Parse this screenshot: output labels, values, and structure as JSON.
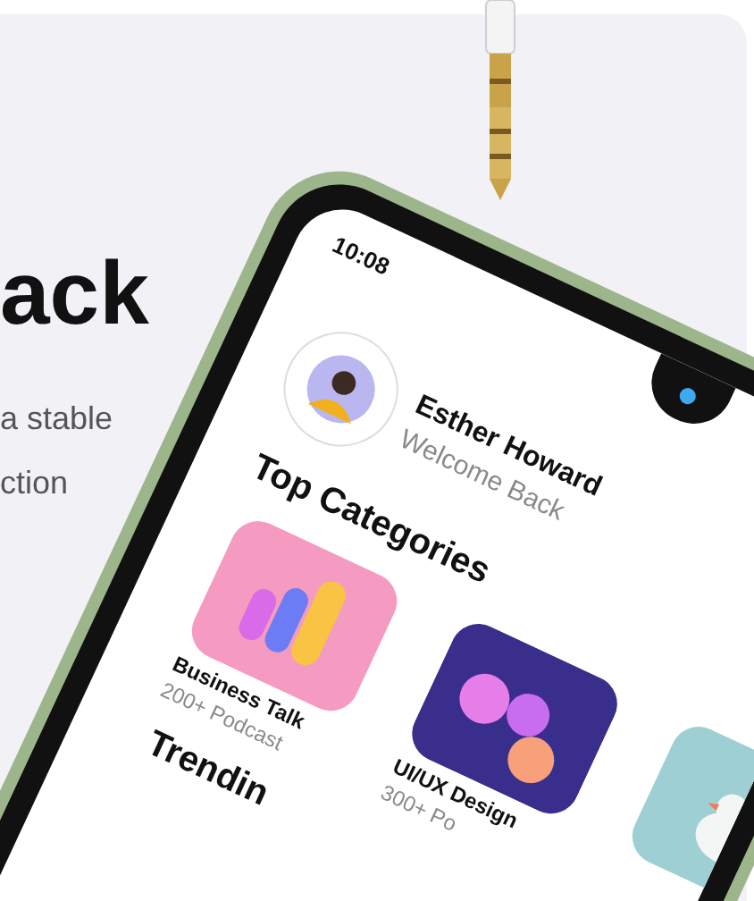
{
  "hero": {
    "title": "ack",
    "lines": [
      "a stable",
      "ction"
    ]
  },
  "phone": {
    "time": "10:08",
    "user": {
      "name": "Esther Howard",
      "greeting": "Welcome Back"
    },
    "section_title": "Top Categories",
    "categories": [
      {
        "kind": "picture",
        "title": "Business Talk",
        "subtitle": "200+ Podcast"
      },
      {
        "kind": "picture",
        "title": "UI/UX Design",
        "subtitle": "300+ Po"
      },
      {
        "kind": "picture"
      }
    ],
    "next_section_title": "Trendin"
  }
}
